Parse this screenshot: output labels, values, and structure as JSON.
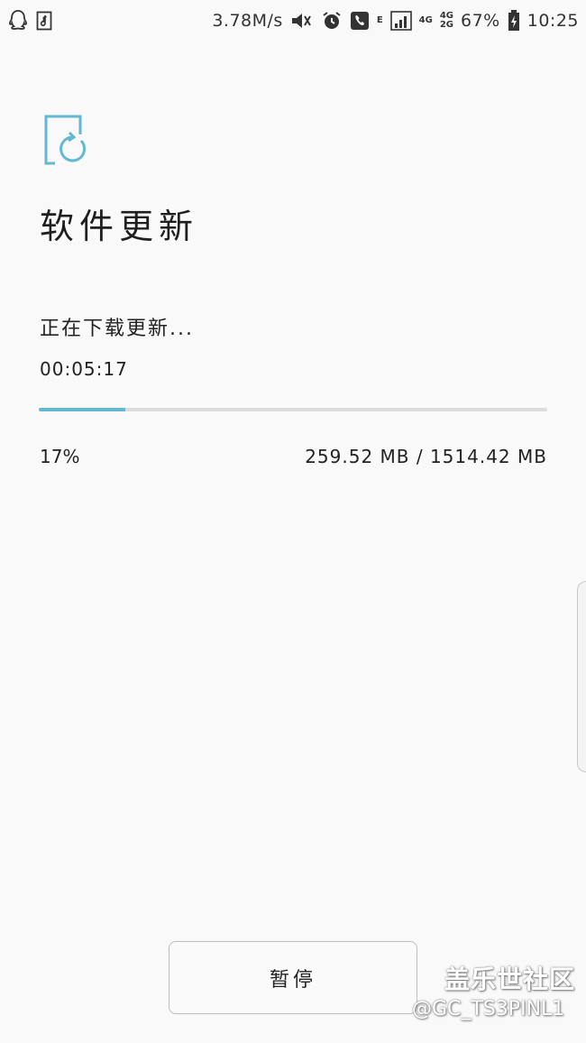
{
  "status_bar": {
    "net_speed": "3.78M/s",
    "network_e": "E",
    "sim1_label": "4G",
    "sim2_label_top": "4G",
    "sim2_label_bottom": "2G",
    "battery_percent": "67%",
    "time": "10:25",
    "icons": [
      "qq-icon",
      "music-file-icon",
      "mute-icon",
      "alarm-icon",
      "phone-icon",
      "signal-icon",
      "battery-charging-icon"
    ]
  },
  "header": {
    "icon": "software-update-icon",
    "title": "软件更新"
  },
  "download": {
    "status": "正在下载更新...",
    "elapsed": "00:05:17",
    "progress_fraction": 0.17,
    "percent_label": "17%",
    "size_label": "259.52 MB / 1514.42 MB"
  },
  "footer": {
    "pause_label": "暂停"
  },
  "watermark": {
    "site": "盖乐世社区",
    "user": "@GC_TS3PINL1"
  },
  "colors": {
    "accent": "#62b8d3",
    "background": "#f9f9f9",
    "track": "#dcdcdc"
  }
}
